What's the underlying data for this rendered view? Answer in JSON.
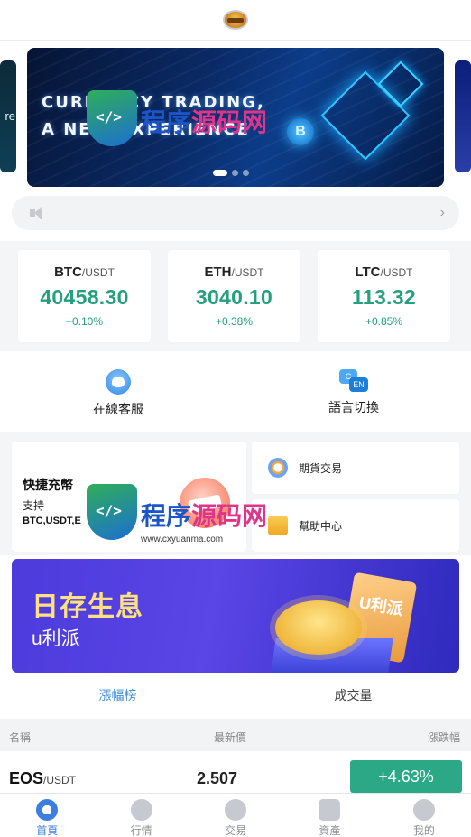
{
  "header": {
    "logo": "app-logo"
  },
  "banner": {
    "side_left_text": "re",
    "line1": "CURRENCY TRADING,",
    "line2": "A NEW EXPERIENCE",
    "coin_symbol": "B",
    "slide_count": 3,
    "active_slide": 1
  },
  "notice": {
    "icon": "speaker-icon",
    "chevron": "›"
  },
  "tickers": [
    {
      "base": "BTC",
      "quote": "/USDT",
      "price": "40458.30",
      "change": "+0.10%"
    },
    {
      "base": "ETH",
      "quote": "/USDT",
      "price": "3040.10",
      "change": "+0.38%"
    },
    {
      "base": "LTC",
      "quote": "/USDT",
      "price": "113.32",
      "change": "+0.85%"
    }
  ],
  "service": {
    "customer_service": "在線客服",
    "language": "語言切換",
    "lang_icon_a": "C",
    "lang_icon_b": "EN"
  },
  "cards": {
    "recharge_title": "快捷充幣",
    "recharge_sub": "支持",
    "recharge_coins": "BTC,USDT,E",
    "futures": "期貨交易",
    "help": "幫助中心"
  },
  "promo": {
    "title": "日存生息",
    "subtitle": "u利派",
    "ticket_text": "U利派"
  },
  "tabs": [
    {
      "label": "漲幅榜",
      "active": true
    },
    {
      "label": "成交量",
      "active": false
    }
  ],
  "table": {
    "headers": {
      "name": "名稱",
      "last": "最新價",
      "change": "漲跌幅"
    },
    "rows": [
      {
        "base": "EOS",
        "quote": "/USDT",
        "last": "2.507",
        "change": "+4.63%"
      }
    ]
  },
  "nav": [
    {
      "label": "首頁",
      "icon": "home-icon",
      "active": true
    },
    {
      "label": "行情",
      "icon": "market-icon",
      "active": false
    },
    {
      "label": "交易",
      "icon": "trade-icon",
      "active": false
    },
    {
      "label": "資產",
      "icon": "wallet-icon",
      "active": false
    },
    {
      "label": "我的",
      "icon": "profile-icon",
      "active": false
    }
  ],
  "watermark": {
    "name_a": "程序",
    "name_b": "源码网",
    "url": "www.cxyuanma.com"
  },
  "colors": {
    "up": "#25a07e",
    "accent": "#3d7fe0",
    "up_badge": "#2ba886"
  }
}
